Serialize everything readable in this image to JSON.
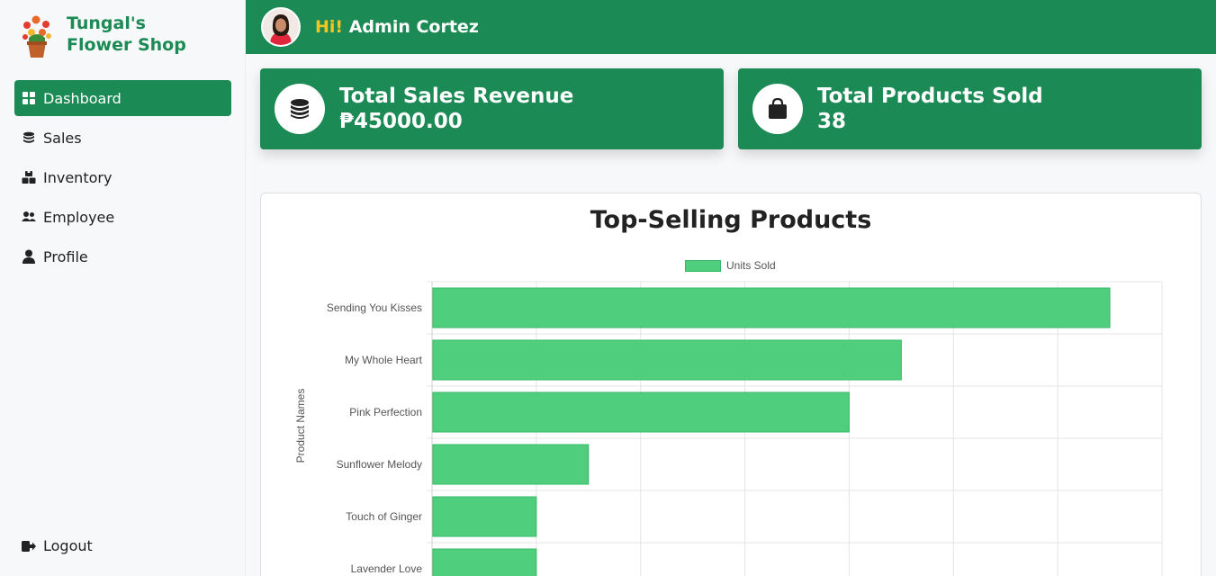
{
  "brand": {
    "name_line1": "Tungal's",
    "name_line2": "Flower Shop"
  },
  "sidebar": {
    "items": [
      {
        "label": "Dashboard",
        "icon": "grid-icon",
        "active": true
      },
      {
        "label": "Sales",
        "icon": "coins-icon",
        "active": false
      },
      {
        "label": "Inventory",
        "icon": "boxes-icon",
        "active": false
      },
      {
        "label": "Employee",
        "icon": "users-icon",
        "active": false
      },
      {
        "label": "Profile",
        "icon": "user-icon",
        "active": false
      }
    ],
    "logout_label": "Logout"
  },
  "header": {
    "hi": "Hi!",
    "user": "Admin Cortez"
  },
  "stats": {
    "revenue": {
      "title": "Total Sales Revenue",
      "value": "₱45000.00",
      "icon": "coins-icon"
    },
    "products": {
      "title": "Total Products Sold",
      "value": "38",
      "icon": "shopping-bag-icon"
    }
  },
  "colors": {
    "primary": "#1b8a55",
    "accent": "#f6c523",
    "bar": "#4fcf7d"
  },
  "chart_data": {
    "type": "bar",
    "orientation": "horizontal",
    "title": "Top-Selling Products",
    "ylabel": "Product Names",
    "categories": [
      "Sending You Kisses",
      "My Whole Heart",
      "Pink Perfection",
      "Sunflower Melody",
      "Touch of Ginger",
      "Lavender Love"
    ],
    "series": [
      {
        "name": "Units Sold",
        "values": [
          13,
          9,
          8,
          3,
          2,
          2
        ]
      }
    ],
    "xlim": [
      0,
      14
    ],
    "grid": true,
    "legend": "top-center"
  }
}
